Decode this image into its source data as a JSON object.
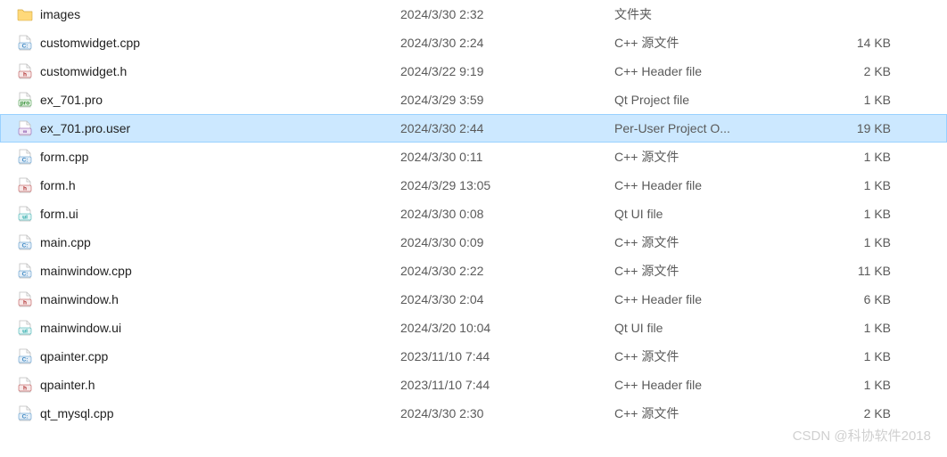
{
  "files": [
    {
      "name": "images",
      "date": "2024/3/30 2:32",
      "type": "文件夹",
      "size": "",
      "icon": "folder-icon",
      "selected": false
    },
    {
      "name": "customwidget.cpp",
      "date": "2024/3/30 2:24",
      "type": "C++ 源文件",
      "size": "14 KB",
      "icon": "cpp-icon",
      "selected": false
    },
    {
      "name": "customwidget.h",
      "date": "2024/3/22 9:19",
      "type": "C++ Header file",
      "size": "2 KB",
      "icon": "h-icon",
      "selected": false
    },
    {
      "name": "ex_701.pro",
      "date": "2024/3/29 3:59",
      "type": "Qt Project file",
      "size": "1 KB",
      "icon": "pro-icon",
      "selected": false
    },
    {
      "name": "ex_701.pro.user",
      "date": "2024/3/30 2:44",
      "type": "Per-User Project O...",
      "size": "19 KB",
      "icon": "user-icon",
      "selected": true
    },
    {
      "name": "form.cpp",
      "date": "2024/3/30 0:11",
      "type": "C++ 源文件",
      "size": "1 KB",
      "icon": "cpp-icon",
      "selected": false
    },
    {
      "name": "form.h",
      "date": "2024/3/29 13:05",
      "type": "C++ Header file",
      "size": "1 KB",
      "icon": "h-icon",
      "selected": false
    },
    {
      "name": "form.ui",
      "date": "2024/3/30 0:08",
      "type": "Qt UI file",
      "size": "1 KB",
      "icon": "ui-icon",
      "selected": false
    },
    {
      "name": "main.cpp",
      "date": "2024/3/30 0:09",
      "type": "C++ 源文件",
      "size": "1 KB",
      "icon": "cpp-icon",
      "selected": false
    },
    {
      "name": "mainwindow.cpp",
      "date": "2024/3/30 2:22",
      "type": "C++ 源文件",
      "size": "11 KB",
      "icon": "cpp-icon",
      "selected": false
    },
    {
      "name": "mainwindow.h",
      "date": "2024/3/30 2:04",
      "type": "C++ Header file",
      "size": "6 KB",
      "icon": "h-icon",
      "selected": false
    },
    {
      "name": "mainwindow.ui",
      "date": "2024/3/20 10:04",
      "type": "Qt UI file",
      "size": "1 KB",
      "icon": "ui-icon",
      "selected": false
    },
    {
      "name": "qpainter.cpp",
      "date": "2023/11/10 7:44",
      "type": "C++ 源文件",
      "size": "1 KB",
      "icon": "cpp-icon",
      "selected": false
    },
    {
      "name": "qpainter.h",
      "date": "2023/11/10 7:44",
      "type": "C++ Header file",
      "size": "1 KB",
      "icon": "h-icon",
      "selected": false
    },
    {
      "name": "qt_mysql.cpp",
      "date": "2024/3/30 2:30",
      "type": "C++ 源文件",
      "size": "2 KB",
      "icon": "cpp-icon",
      "selected": false
    }
  ],
  "watermark": "CSDN @科协软件2018",
  "icons": {
    "folder-icon": {
      "kind": "folder"
    },
    "cpp-icon": {
      "kind": "file",
      "badge": "C:",
      "badgeColor": "#3a86c2",
      "badgeBg": "#e4eef7"
    },
    "h-icon": {
      "kind": "file",
      "badge": "h",
      "badgeColor": "#b03030",
      "badgeBg": "#f7e8e8"
    },
    "pro-icon": {
      "kind": "file",
      "badge": "pro",
      "badgeColor": "#2e8b2e",
      "badgeBg": "#e6f3e6"
    },
    "user-icon": {
      "kind": "file",
      "badge": "∞",
      "badgeColor": "#7a3fa0",
      "badgeBg": "#efe6f5"
    },
    "ui-icon": {
      "kind": "file",
      "badge": "ui",
      "badgeColor": "#1aa3a3",
      "badgeBg": "#e2f4f4"
    }
  }
}
